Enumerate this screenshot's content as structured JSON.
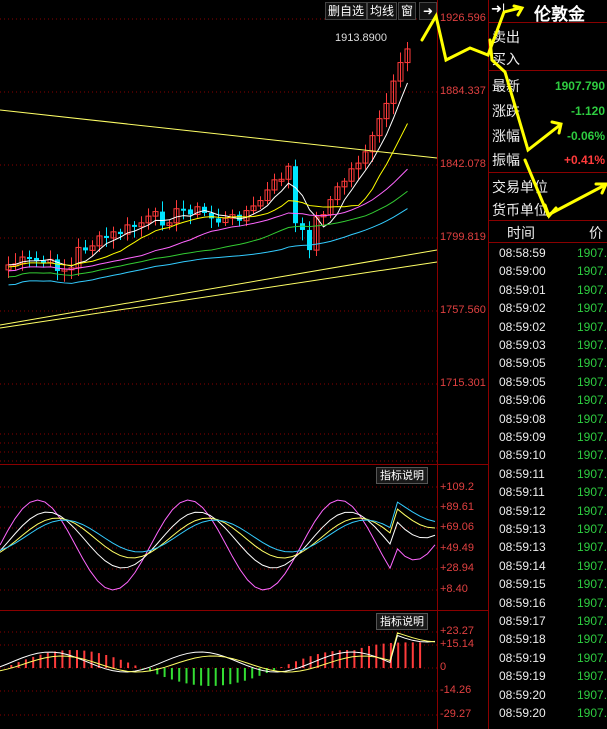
{
  "toolbar": {
    "buttons": [
      "删自选",
      "均线",
      "窗"
    ]
  },
  "main_chart": {
    "last_price_label": "1913.8900",
    "price_axis": [
      "1926.596",
      "1884.337",
      "1842.078",
      "1799.819",
      "1757.560",
      "1715.301"
    ]
  },
  "indicator_panel_1": {
    "label": "指标说明",
    "axis": [
      "+109.2",
      "+89.61",
      "+69.06",
      "+49.49",
      "+28.94",
      "+8.40"
    ]
  },
  "indicator_panel_2": {
    "label": "指标说明",
    "axis": [
      "+23.27",
      "+15.14",
      "0",
      "-14.26",
      "-29.27"
    ]
  },
  "quote_panel": {
    "title": "伦敦金",
    "rows": [
      {
        "label": "卖出",
        "value": "",
        "color": "#ffffff"
      },
      {
        "label": "买入",
        "value": "",
        "color": "#ffffff"
      },
      {
        "label": "最新",
        "value": "1907.790",
        "color": "#2ecc40"
      },
      {
        "label": "涨跌",
        "value": "-1.120",
        "color": "#2ecc40"
      },
      {
        "label": "涨幅",
        "value": "-0.06%",
        "color": "#2ecc40"
      },
      {
        "label": "振幅",
        "value": "+0.41%",
        "color": "#ff3b3b"
      },
      {
        "label": "交易单位",
        "value": "",
        "color": "#ffffff"
      },
      {
        "label": "货币单位",
        "value": "",
        "color": "#ffffff"
      }
    ],
    "table_headers": [
      "时间",
      "价"
    ],
    "ticks": [
      {
        "time": "08:58:59",
        "price": "1907."
      },
      {
        "time": "08:59:00",
        "price": "1907."
      },
      {
        "time": "08:59:01",
        "price": "1907."
      },
      {
        "time": "08:59:02",
        "price": "1907."
      },
      {
        "time": "08:59:02",
        "price": "1907."
      },
      {
        "time": "08:59:03",
        "price": "1907."
      },
      {
        "time": "08:59:05",
        "price": "1907."
      },
      {
        "time": "08:59:05",
        "price": "1907."
      },
      {
        "time": "08:59:06",
        "price": "1907."
      },
      {
        "time": "08:59:08",
        "price": "1907."
      },
      {
        "time": "08:59:09",
        "price": "1907."
      },
      {
        "time": "08:59:10",
        "price": "1907."
      },
      {
        "time": "08:59:11",
        "price": "1907."
      },
      {
        "time": "08:59:11",
        "price": "1907."
      },
      {
        "time": "08:59:12",
        "price": "1907."
      },
      {
        "time": "08:59:13",
        "price": "1907."
      },
      {
        "time": "08:59:13",
        "price": "1907."
      },
      {
        "time": "08:59:14",
        "price": "1907."
      },
      {
        "time": "08:59:15",
        "price": "1907."
      },
      {
        "time": "08:59:16",
        "price": "1907."
      },
      {
        "time": "08:59:17",
        "price": "1907."
      },
      {
        "time": "08:59:18",
        "price": "1907."
      },
      {
        "time": "08:59:19",
        "price": "1907."
      },
      {
        "time": "08:59:19",
        "price": "1907."
      },
      {
        "time": "08:59:20",
        "price": "1907."
      },
      {
        "time": "08:59:20",
        "price": "1907."
      }
    ]
  },
  "colors": {
    "up": "#ff3b3b",
    "down": "#00e5ff",
    "grid": "#8a0000",
    "annotation": "#ffff00",
    "trendline": "#ffff66"
  },
  "icons": {
    "collapse": "collapse-right-icon",
    "expand": "expand-panel-icon"
  }
}
